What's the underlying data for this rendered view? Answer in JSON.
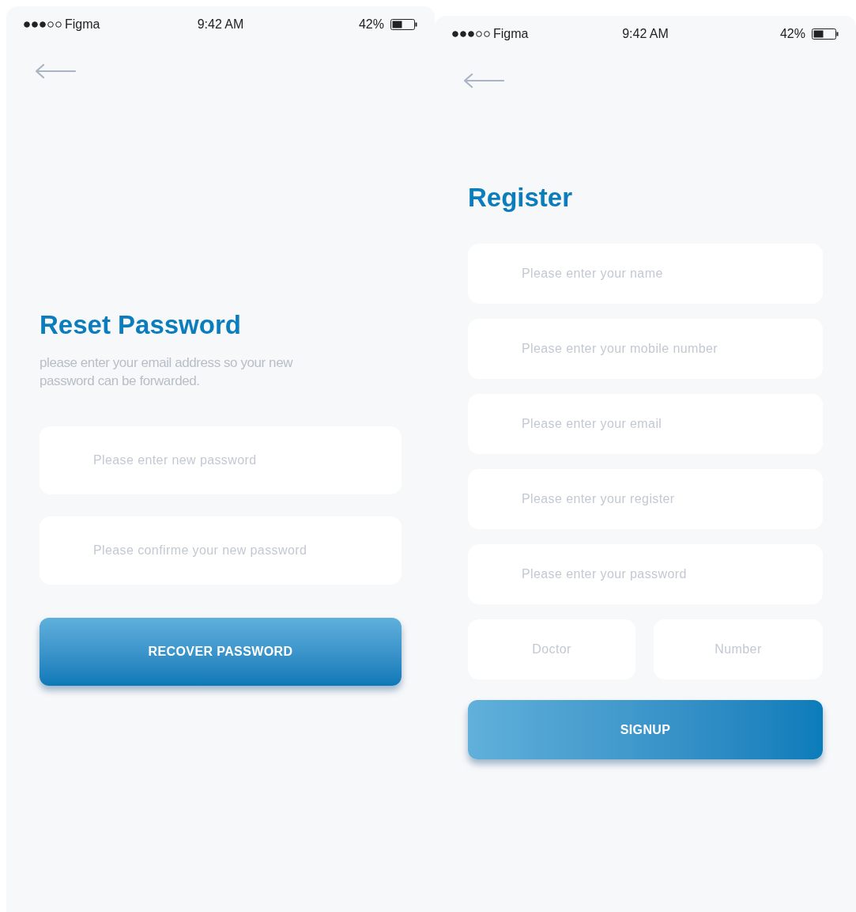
{
  "screens": [
    {
      "kind": "reset",
      "status_bar": {
        "carrier": "Figma",
        "time": "9:42 AM",
        "battery": "42%"
      },
      "title": "Reset Password",
      "subtitle": "please enter your email address so your new password can be forwarded.",
      "fields": [
        {
          "placeholder": "Please enter new password"
        },
        {
          "placeholder": "Please confirme your new password"
        }
      ],
      "button": "RECOVER PASSWORD"
    },
    {
      "kind": "register",
      "status_bar": {
        "carrier": "Figma",
        "time": "9:42 AM",
        "battery": "42%"
      },
      "title": "Register",
      "fields": [
        {
          "placeholder": "Please enter your name"
        },
        {
          "placeholder": "Please enter your mobile number"
        },
        {
          "placeholder": "Please enter your email"
        },
        {
          "placeholder": "Please enter your register"
        },
        {
          "placeholder": "Please enter your password"
        }
      ],
      "pair_fields": [
        {
          "placeholder": "Doctor"
        },
        {
          "placeholder": "Number"
        }
      ],
      "button": "SIGNUP"
    }
  ]
}
